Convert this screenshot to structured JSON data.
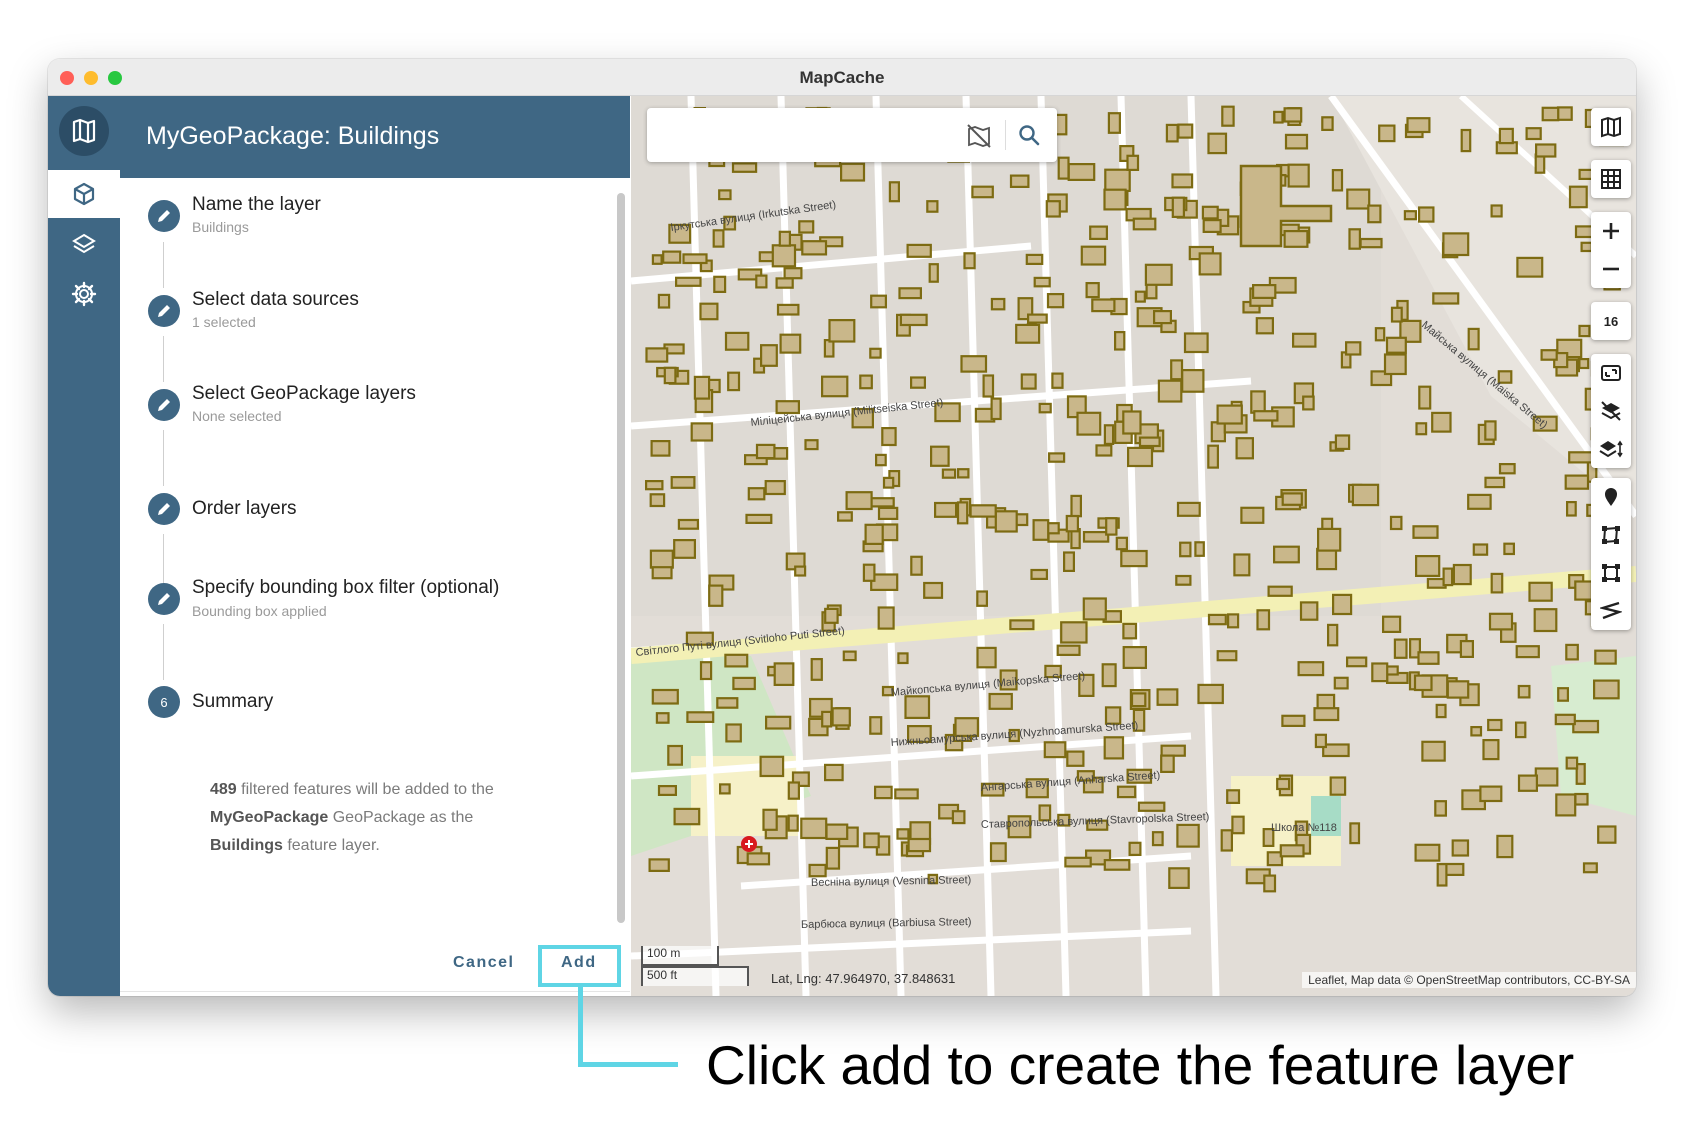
{
  "window": {
    "title": "MapCache"
  },
  "header": {
    "title": "MyGeoPackage: Buildings"
  },
  "steps": [
    {
      "title": "Name the layer",
      "subtitle": "Buildings",
      "marker": "pencil-icon"
    },
    {
      "title": "Select data sources",
      "subtitle": "1 selected",
      "marker": "pencil-icon"
    },
    {
      "title": "Select GeoPackage layers",
      "subtitle": "None selected",
      "marker": "pencil-icon"
    },
    {
      "title": "Order layers",
      "subtitle": "",
      "marker": "pencil-icon"
    },
    {
      "title": "Specify bounding box filter (optional)",
      "subtitle": "Bounding box applied",
      "marker": "pencil-icon"
    },
    {
      "title": "Summary",
      "subtitle": "",
      "number": "6"
    }
  ],
  "summary": {
    "count": "489",
    "text_1": " filtered features will be added to the ",
    "geopackage": "MyGeoPackage",
    "text_2": " GeoPackage as the ",
    "layer": "Buildings",
    "text_3": " feature layer."
  },
  "actions": {
    "cancel": "Cancel",
    "add": "Add"
  },
  "map": {
    "zoom": "16",
    "scale_metric": "100 m",
    "scale_imperial": "500 ft",
    "coordinates": "Lat, Lng: 47.964970, 37.848631",
    "attribution": "Leaflet, Map data © OpenStreetMap contributors, CC-BY-SA",
    "street_labels": [
      "Іркутська вулиця (Irkutska Street)",
      "Міліцейська вулиця (Militseiska Street)",
      "Світлого Путі вулиця (Svitloho Puti Street)",
      "Майкопська вулиця (Maikopska Street)",
      "Нижньоамурська вулиця (Nyzhnoamurska Street)",
      "Ангарська вулиця (Anharska Street)",
      "Ставропольська вулиця (Stavropolska Street)",
      "Весніна вулиця (Vesnina Street)",
      "Барбюса вулиця (Barbiusa Street)",
      "Майська вулиця (Maiska Street)",
      "Школа №118"
    ],
    "colors": {
      "building_fill": "#c9b78a",
      "building_stroke": "#7d6b12",
      "road": "#ffffff",
      "main_road": "#f3f0b5"
    }
  },
  "annotation": {
    "caption": "Click add to create the feature layer",
    "color": "#5fd5e5"
  }
}
